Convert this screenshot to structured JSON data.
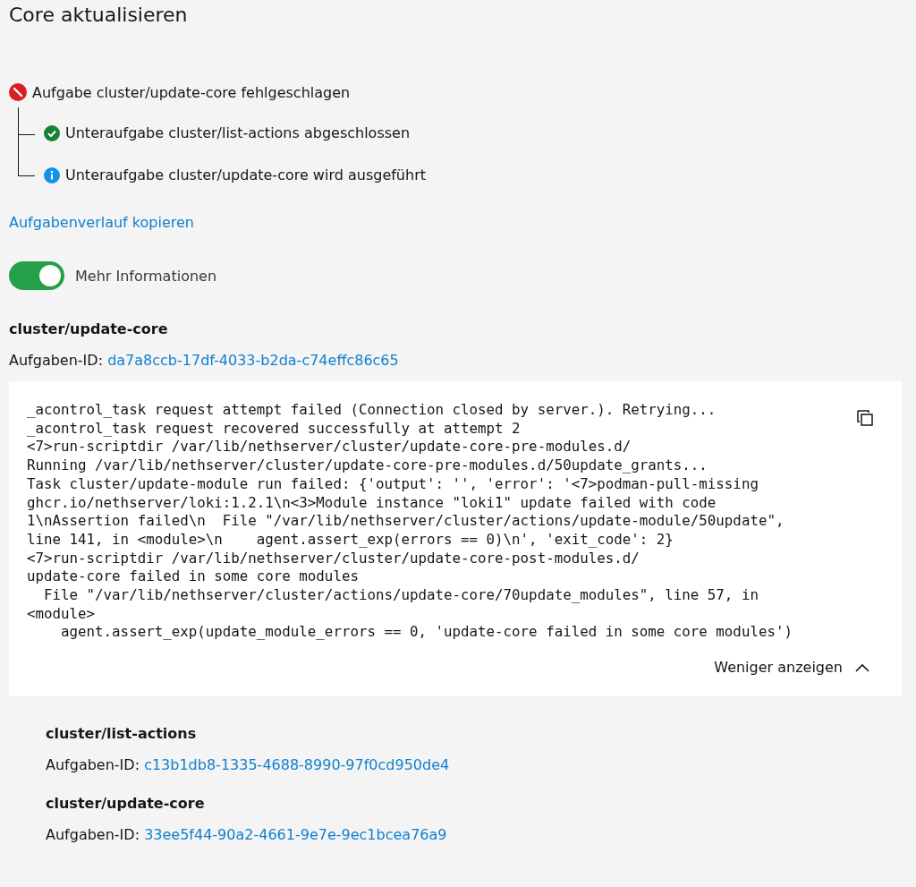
{
  "title": "Core aktualisieren",
  "task": {
    "kind": "error",
    "label": "Aufgabe cluster/update-core fehlgeschlagen",
    "children": [
      {
        "kind": "success",
        "label": "Unteraufgabe cluster/list-actions abgeschlossen"
      },
      {
        "kind": "info",
        "label": "Unteraufgabe cluster/update-core wird ausgeführt"
      }
    ]
  },
  "copy_link": "Aufgabenverlauf kopieren",
  "more_info": {
    "label": "Mehr Informationen",
    "on": true
  },
  "details": [
    {
      "name": "cluster/update-core",
      "id_label": "Aufgaben-ID:",
      "id": "da7a8ccb-17df-4033-b2da-c74effc86c65",
      "log": "_acontrol_task request attempt failed (Connection closed by server.). Retrying...\n_acontrol_task request recovered successfully at attempt 2\n<7>run-scriptdir /var/lib/nethserver/cluster/update-core-pre-modules.d/\nRunning /var/lib/nethserver/cluster/update-core-pre-modules.d/50update_grants...\nTask cluster/update-module run failed: {'output': '', 'error': '<7>podman-pull-missing\nghcr.io/nethserver/loki:1.2.1\\n<3>Module instance \"loki1\" update failed with code\n1\\nAssertion failed\\n  File \"/var/lib/nethserver/cluster/actions/update-module/50update\",\nline 141, in <module>\\n    agent.assert_exp(errors == 0)\\n', 'exit_code': 2}\n<7>run-scriptdir /var/lib/nethserver/cluster/update-core-post-modules.d/\nupdate-core failed in some core modules\n  File \"/var/lib/nethserver/cluster/actions/update-core/70update_modules\", line 57, in\n<module>\n    agent.assert_exp(update_module_errors == 0, 'update-core failed in some core modules')",
      "toggle": "Weniger anzeigen",
      "children": [
        {
          "name": "cluster/list-actions",
          "id_label": "Aufgaben-ID:",
          "id": "c13b1db8-1335-4688-8990-97f0cd950de4"
        },
        {
          "name": "cluster/update-core",
          "id_label": "Aufgaben-ID:",
          "id": "33ee5f44-90a2-4661-9e7e-9ec1bcea76a9"
        }
      ]
    }
  ]
}
